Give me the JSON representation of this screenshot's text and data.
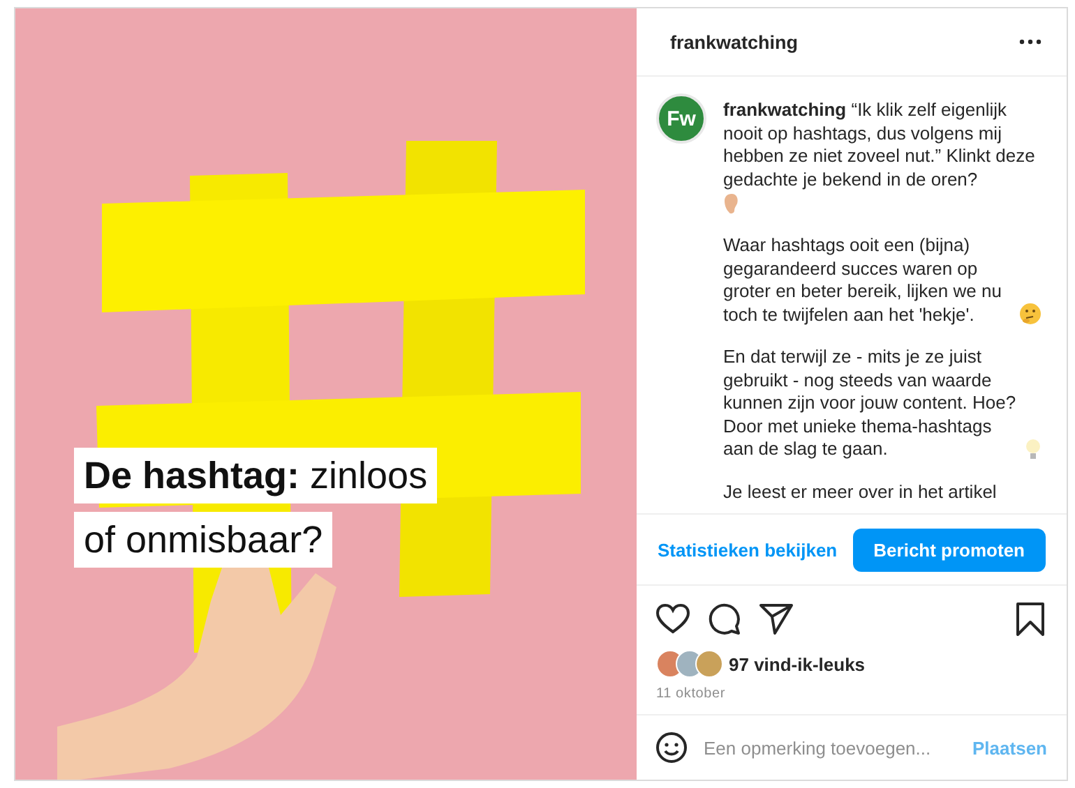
{
  "post_image": {
    "headline_lines": [
      "**De hashtag:** zinloos",
      "of onmisbaar?"
    ]
  },
  "header": {
    "username": "frankwatching"
  },
  "caption": {
    "avatar_initials": "Fw",
    "paragraphs": [
      {
        "text": "**frankwatching** “Ik klik zelf eigenlijk nooit op hashtags, dus volgens mij hebben ze niet zoveel nut.” Klinkt deze gedachte je bekend in de oren?",
        "kind": "ear"
      },
      {
        "text": "Waar hashtags ooit een (bijna) gegarandeerd succes waren op groter en beter bereik, lijken we nu toch te twijfelen aan het 'hekje'.",
        "kind": "thinking"
      },
      {
        "text": "En dat terwijl ze - mits je ze juist gebruikt - nog steeds van waarde kunnen zijn voor jouw content. Hoe? Door met unieke thema-hashtags aan de slag te gaan.",
        "kind": "bulb"
      },
      {
        "text": "Je leest er meer over in het artikel",
        "kind": "plain"
      }
    ]
  },
  "actions": {
    "insights_link": "Statistieken bekijken",
    "promote_button": "Bericht promoten",
    "saved": false,
    "liked": false
  },
  "likes": {
    "count": "97 vind-ik-leuks",
    "date": "11 oktober",
    "likers": [
      {
        "color": "#d9835f"
      },
      {
        "color": "#9fb3bf"
      },
      {
        "color": "#c9a15a"
      }
    ]
  },
  "comment": {
    "placeholder": "Een opmerking toevoegen...",
    "post_button": "Plaatsen",
    "disabled": true
  }
}
